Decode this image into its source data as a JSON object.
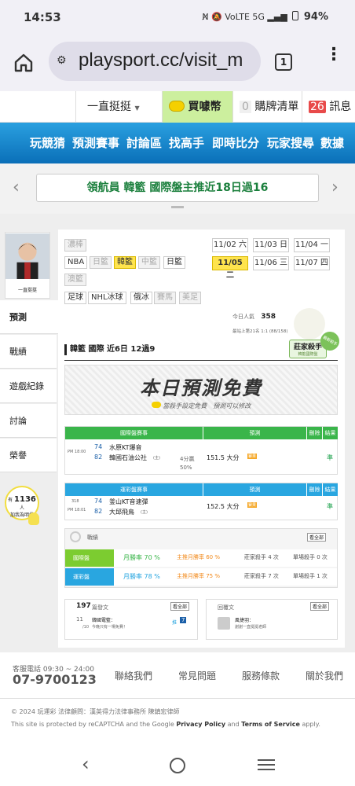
{
  "status_bar": {
    "time": "14:53",
    "icons": "N̸ 🔕 VoLTE 5G ▂▄▆",
    "battery": "94%"
  },
  "browser": {
    "url": "playsport.cc/visit_m",
    "tab_count": "1"
  },
  "topnav": {
    "user": "一直挺挺",
    "buy": "買噱幣",
    "cart_count": "0",
    "cart": "購牌清單",
    "msg_count": "26",
    "msg": "訊息"
  },
  "mainmenu": [
    "玩競猜",
    "預測賽事",
    "討論區",
    "找高手",
    "即時比分",
    "玩家搜尋",
    "數據"
  ],
  "marquee": {
    "text": "領航員 韓籃 國際盤主推近18日過16"
  },
  "sidebar": {
    "username": "一直挺挺",
    "items": [
      "預測",
      "戰績",
      "遊戲紀錄",
      "討論",
      "榮譽"
    ],
    "badge_count": "1136",
    "badge_unit": "人",
    "badge_label": "加我為明燈",
    "badge_prefix": "有"
  },
  "leagues": {
    "row1": [
      "濃棒"
    ],
    "row2": [
      "NBA",
      "日籃",
      "韓籃",
      "中籃",
      "日籃"
    ],
    "row3": [
      "澳籃"
    ],
    "row4": [
      "足球",
      "NHL冰球",
      "俄冰",
      "賽馬",
      "美足"
    ]
  },
  "dates": [
    "11/02 六",
    "11/03 日",
    "11/04 一",
    "11/05 二",
    "11/06 三",
    "11/07 四"
  ],
  "visitors": {
    "today_label": "今日人氣",
    "today": "358",
    "rank": "最站上第21名 1:1 (88/158)"
  },
  "badge_master": {
    "text": "莊家殺手",
    "sub": "韓籃國際盤",
    "stamp": "最新殺手"
  },
  "record": {
    "text": "韓籃 國際 近6日 12過9"
  },
  "free_banner": {
    "title": "本日預測免費",
    "sub": "當殺手設定免費　預測可以修改"
  },
  "table1": {
    "headers": [
      "國際盤賽事",
      "預測",
      "刪除",
      "結果"
    ],
    "time": "PM 18:00",
    "home_no": "74",
    "home": "水原KT爆音",
    "away_no": "82",
    "away": "韓國石油公社",
    "away_tag": "(主)",
    "odds_top": "4分贏",
    "odds_bottom": "50%",
    "pick": "151.5 大分",
    "pick_tag": "賽果",
    "result": "準"
  },
  "table2": {
    "headers": [
      "運彩盤賽事",
      "預測",
      "刪除",
      "結果"
    ],
    "serial": "318",
    "time": "PM 18:01",
    "home_no": "74",
    "home": "釜山KT音速彈",
    "away_no": "82",
    "away": "大邱飛鳥",
    "away_tag": "(主)",
    "pick": "152.5 大分",
    "pick_tag": "賽果",
    "result": "準"
  },
  "stats": {
    "title": "戰績",
    "see_all": "看全部",
    "rows": [
      {
        "label": "國際盤",
        "rate": "月勝率 70 %",
        "home_rate": "主推月勝率 60 %",
        "killer": "莊家殺手 4 次",
        "single": "單場殺手 0 次"
      },
      {
        "label": "運彩盤",
        "rate": "月勝率 78 %",
        "home_rate": "主推月勝率 75 %",
        "killer": "莊家殺手 7 次",
        "single": "單場殺手 1 次"
      }
    ]
  },
  "posts": {
    "count": "197",
    "count_label": "篇發文",
    "see_all": "看全部",
    "item_num": "11",
    "item_sub": "/10",
    "item_title": "韓國電籃：",
    "item_text": "今晚只有一場免費！",
    "item_tag": "推",
    "item_score": "7"
  },
  "replies": {
    "label": "回覆文",
    "see_all": "看全部",
    "item_title": "風捷羽：",
    "item_text": "謝謝一直挺挺老師"
  },
  "footer": {
    "phone_label": "客服電話 09:30 ~ 24:00",
    "phone": "07-9700123",
    "links": [
      "聯絡我們",
      "常見問題",
      "服務條款",
      "關於我們"
    ],
    "copyright": "© 2024 玩運彩 法律顧問：漢英得力法律事務所 陳鎮宏律師",
    "recaptcha_1": "This site is protected by reCAPTCHA and the Google ",
    "privacy": "Privacy Policy",
    "and": " and ",
    "terms": "Terms of Service",
    "apply": " apply."
  },
  "colors": {
    "menu_blue": "#0a6fb8",
    "green_header": "#3ab54a",
    "blue_header": "#29a6e0",
    "yellow": "#ffe44d"
  }
}
